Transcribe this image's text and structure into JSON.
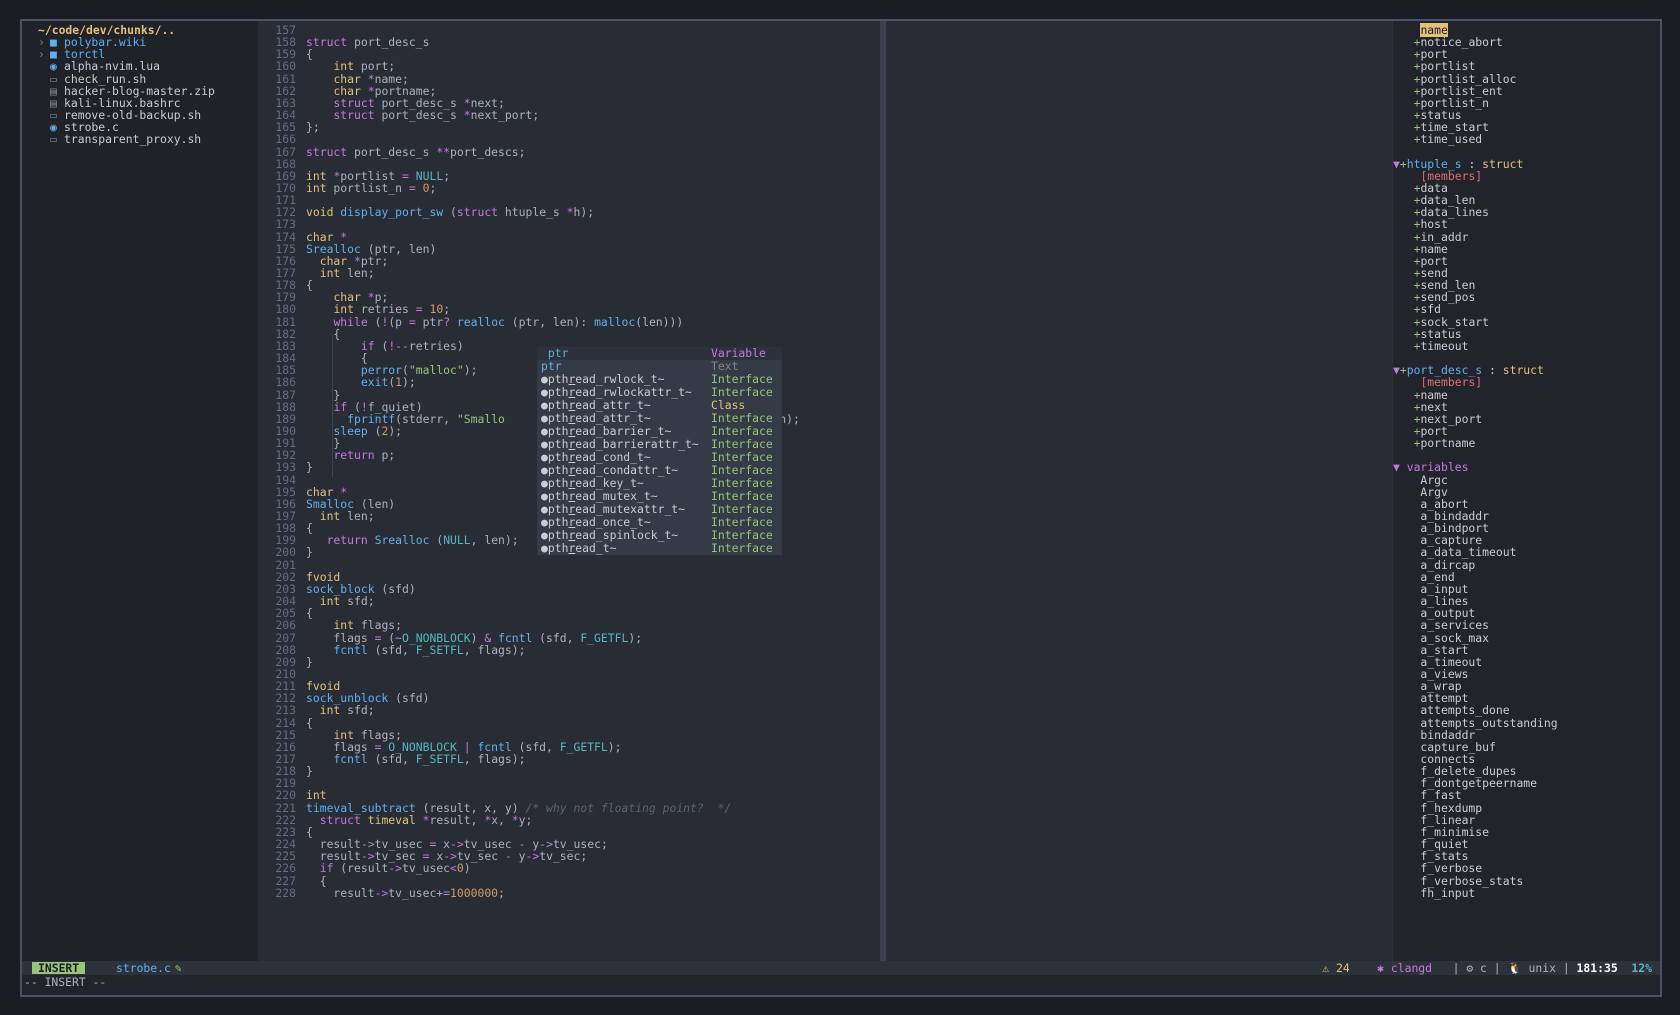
{
  "file_tree": {
    "root": "~/code/dev/chunks/..",
    "items": [
      {
        "name": "polybar.wiki",
        "kind": "dir",
        "arrow": "›",
        "icon": "■"
      },
      {
        "name": "torctl",
        "kind": "dir",
        "arrow": "›",
        "icon": "■"
      },
      {
        "name": "alpha-nvim.lua",
        "kind": "file",
        "arrow": "",
        "icon": "◉"
      },
      {
        "name": "check_run.sh",
        "kind": "file",
        "arrow": "",
        "icon": "▭"
      },
      {
        "name": "hacker-blog-master.zip",
        "kind": "file",
        "arrow": "",
        "icon": "▤"
      },
      {
        "name": "kali-linux.bashrc",
        "kind": "file",
        "arrow": "",
        "icon": "▤"
      },
      {
        "name": "remove-old-backup.sh",
        "kind": "file",
        "arrow": "",
        "icon": "▭"
      },
      {
        "name": "strobe.c",
        "kind": "file",
        "arrow": "",
        "icon": "◉"
      },
      {
        "name": "transparent_proxy.sh",
        "kind": "file",
        "arrow": "",
        "icon": "▭"
      }
    ]
  },
  "editor": {
    "first_line": 157,
    "lines": [
      "",
      "struct port_desc_s",
      "{",
      "    int port;",
      "    char *name;",
      "    char *portname;",
      "    struct port_desc_s *next;",
      "    struct port_desc_s *next_port;",
      "};",
      "",
      "struct port_desc_s **port_descs;",
      "",
      "int *portlist = NULL;",
      "int portlist_n = 0;",
      "",
      "void display_port_sw (struct htuple_s *h);",
      "",
      "char *",
      "Srealloc (ptr, len)",
      "  char *ptr;",
      "  int len;",
      "{",
      "    char *p;",
      "    int retries = 10;",
      "    while (!(p = ptr? realloc (ptr, len): malloc(len)))",
      "    {",
      "        if (!--retries)",
      "        {",
      "        perror(\"malloc\");",
      "        exit(1);",
      "    }",
      "    if (!f_quiet)",
      "      fprintf(stderr, \"Smallo                            eping\\n\", len);",
      "    sleep (2);",
      "    }",
      "    return p;",
      "}",
      "",
      "char *",
      "Smalloc (len)",
      "  int len;",
      "{",
      "   return Srealloc (NULL, len);",
      "}",
      "",
      "fvoid",
      "sock_block (sfd)",
      "  int sfd;",
      "{",
      "    int flags;",
      "    flags = (~O_NONBLOCK) & fcntl (sfd, F_GETFL);",
      "    fcntl (sfd, F_SETFL, flags);",
      "}",
      "",
      "fvoid",
      "sock_unblock (sfd)",
      "  int sfd;",
      "{",
      "    int flags;",
      "    flags = O_NONBLOCK | fcntl (sfd, F_GETFL);",
      "    fcntl (sfd, F_SETFL, flags);",
      "}",
      "",
      "int",
      "timeval_subtract (result, x, y) /* why not floating point?  */",
      "  struct timeval *result, *x, *y;",
      "{",
      "  result->tv_usec = x->tv_usec - y->tv_usec;",
      "  result->tv_sec = x->tv_sec - y->tv_sec;",
      "  if (result->tv_usec<0)",
      "  {",
      "    result->tv_usec+=1000000;"
    ]
  },
  "completion": {
    "items": [
      {
        "word": " ptr",
        "kind": "Variable"
      },
      {
        "word": "ptr",
        "kind": "Text"
      },
      {
        "word": "pthread_rwlock_t~",
        "kind": "Interface"
      },
      {
        "word": "pthread_rwlockattr_t~",
        "kind": "Interface"
      },
      {
        "word": "pthread_attr_t~",
        "kind": "Class"
      },
      {
        "word": "pthread_attr_t~",
        "kind": "Interface"
      },
      {
        "word": "pthread_barrier_t~",
        "kind": "Interface"
      },
      {
        "word": "pthread_barrierattr_t~",
        "kind": "Interface"
      },
      {
        "word": "pthread_cond_t~",
        "kind": "Interface"
      },
      {
        "word": "pthread_condattr_t~",
        "kind": "Interface"
      },
      {
        "word": "pthread_key_t~",
        "kind": "Interface"
      },
      {
        "word": "pthread_mutex_t~",
        "kind": "Interface"
      },
      {
        "word": "pthread_mutexattr_t~",
        "kind": "Interface"
      },
      {
        "word": "pthread_once_t~",
        "kind": "Interface"
      },
      {
        "word": "pthread_spinlock_t~",
        "kind": "Interface"
      },
      {
        "word": "pthread_t~",
        "kind": "Interface"
      }
    ]
  },
  "outline": {
    "top_members": [
      "name",
      "notice_abort",
      "port",
      "portlist",
      "portlist_alloc",
      "portlist_ent",
      "portlist_n",
      "status",
      "time_start",
      "time_used"
    ],
    "groups": [
      {
        "name": "htuple_s",
        "sep": " : ",
        "kind": "struct",
        "members_label": "[members]",
        "members": [
          "data",
          "data_len",
          "data_lines",
          "host",
          "in_addr",
          "name",
          "port",
          "send",
          "send_len",
          "send_pos",
          "sfd",
          "sock_start",
          "status",
          "timeout"
        ]
      },
      {
        "name": "port_desc_s",
        "sep": " : ",
        "kind": "struct",
        "members_label": "[members]",
        "members": [
          "name",
          "next",
          "next_port",
          "port",
          "portname"
        ]
      }
    ],
    "variables_label": "variables",
    "variables": [
      "Argc",
      "Argv",
      "a_abort",
      "a_bindaddr",
      "a_bindport",
      "a_capture",
      "a_data_timeout",
      "a_dircap",
      "a_end",
      "a_input",
      "a_lines",
      "a_output",
      "a_services",
      "a_sock_max",
      "a_start",
      "a_timeout",
      "a_views",
      "a_wrap",
      "attempt",
      "attempts_done",
      "attempts_outstanding",
      "bindaddr",
      "capture_buf",
      "connects",
      "f_delete_dupes",
      "f_dontgetpeername",
      "f_fast",
      "f_hexdump",
      "f_linear",
      "f_minimise",
      "f_quiet",
      "f_stats",
      "f_verbose",
      "f_verbose_stats",
      "fh_input"
    ]
  },
  "statusline": {
    "mode": "INSERT",
    "filename": "strobe.c",
    "modified_icon": "✎",
    "warnings": "⚠ 24",
    "lsp": "✱ clangd",
    "filetype": "⚙ c",
    "format": "🐧 unix",
    "position": "181:35",
    "percent": "12%"
  },
  "cmdline": "-- INSERT --"
}
